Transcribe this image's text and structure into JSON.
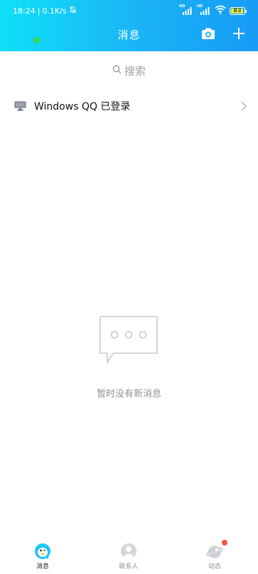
{
  "status_bar": {
    "time": "18:24",
    "network_speed": "0.1K/s",
    "sim1_label": "HD",
    "sim2_label": "HD",
    "battery_level": "83"
  },
  "header": {
    "title": "消息",
    "camera_icon": "camera-icon",
    "add_icon": "plus-icon",
    "background_gradient": [
      "#10e0f7",
      "#179bf5"
    ]
  },
  "search": {
    "placeholder": "搜索",
    "icon": "search-icon"
  },
  "device_notice": {
    "icon": "desktop-computer-icon",
    "label": "Windows QQ 已登录",
    "chevron": "chevron-right-icon"
  },
  "empty_state": {
    "icon": "chat-bubble-icon",
    "text": "暂时没有新消息"
  },
  "bottom_nav": {
    "items": [
      {
        "label": "消息",
        "icon": "qq-penguin-icon",
        "active": true
      },
      {
        "label": "联系人",
        "icon": "contact-person-icon",
        "active": false
      },
      {
        "label": "动态",
        "icon": "planet-icon",
        "active": false,
        "badge": true
      }
    ],
    "badge_color": "#f1563f"
  }
}
